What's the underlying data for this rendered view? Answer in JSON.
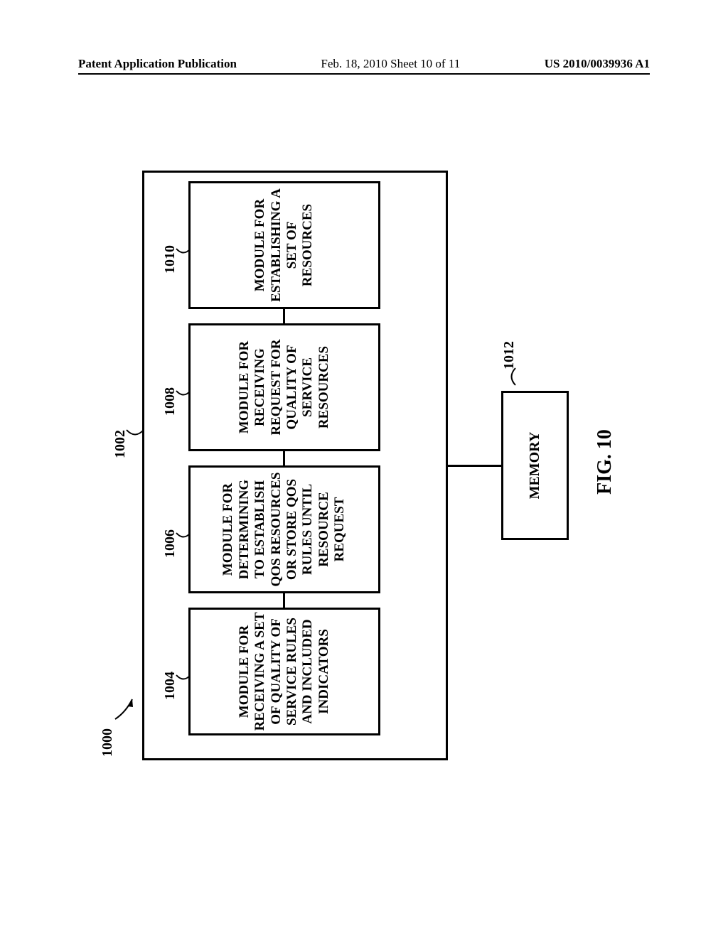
{
  "header": {
    "left": "Patent Application Publication",
    "mid": "Feb. 18, 2010  Sheet 10 of 11",
    "right": "US 2010/0039936 A1"
  },
  "refs": {
    "system": "1000",
    "outer": "1002",
    "m1": "1004",
    "m2": "1006",
    "m3": "1008",
    "m4": "1010",
    "memory": "1012"
  },
  "modules": {
    "m1": "MODULE FOR RECEIVING A SET OF QUALITY OF SERVICE RULES AND INCLUDED INDICATORS",
    "m2": "MODULE FOR DETERMINING TO ESTABLISH QOS RESOURCES OR STORE QOS RULES UNTIL RESOURCE REQUEST",
    "m3": "MODULE FOR RECEIVING REQUEST FOR QUALITY OF SERVICE RESOURCES",
    "m4": "MODULE FOR ESTABLISHING A SET OF RESOURCES"
  },
  "memory_label": "MEMORY",
  "figure_caption": "FIG. 10"
}
